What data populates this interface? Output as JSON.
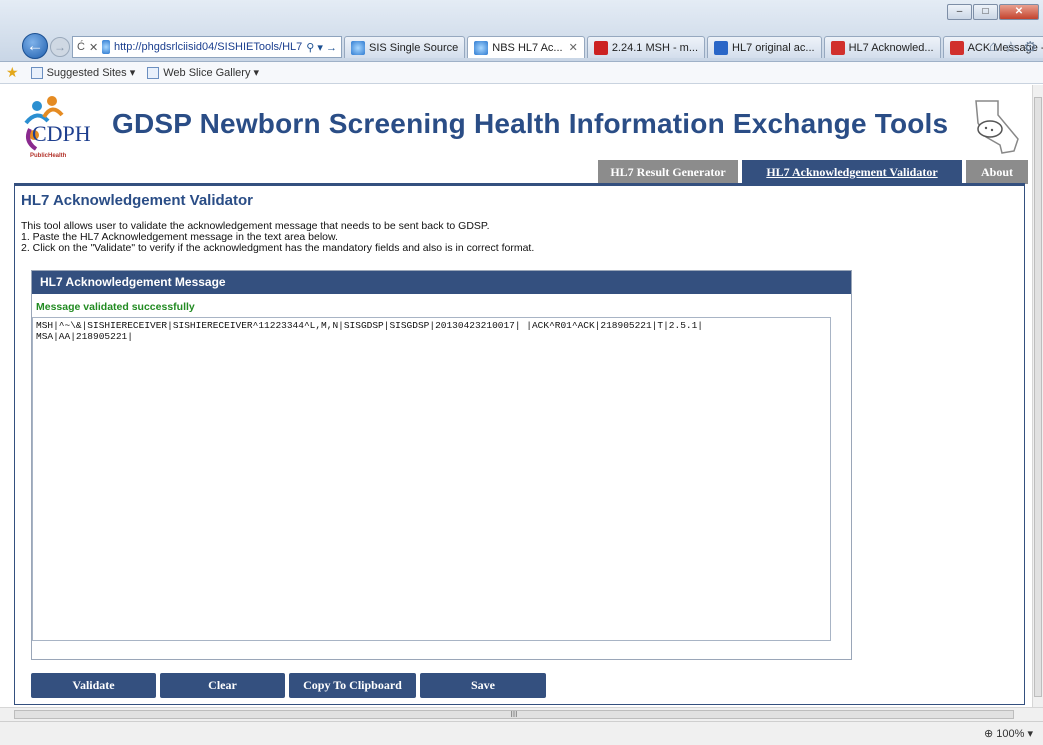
{
  "browser": {
    "url": "http://phgdsrlciisid04/SISHIETools/HL7",
    "tabs": [
      {
        "label": "SIS Single Source",
        "icon": "ie-page-icon"
      },
      {
        "label": "NBS HL7 Ac...",
        "icon": "ie-page-icon"
      },
      {
        "label": "2.24.1 MSH - m...",
        "icon": "red-page-icon"
      },
      {
        "label": "HL7 original ac...",
        "icon": "blue-page-icon"
      },
      {
        "label": "HL7 Acknowled...",
        "icon": "red-page-icon"
      },
      {
        "label": "ACK Message -...",
        "icon": "red-page-icon"
      }
    ],
    "favorites": [
      "Suggested Sites ▾",
      "Web Slice Gallery ▾"
    ],
    "zoom": "100%",
    "hscroll_glyph": "III"
  },
  "header": {
    "logo_text": "CDPH",
    "logo_sub": "PublicHealth",
    "title": "GDSP Newborn Screening Health Information Exchange Tools"
  },
  "nav": {
    "tabs": [
      {
        "label": "HL7 Result Generator",
        "active": false
      },
      {
        "label": "HL7 Acknowledgement Validator",
        "active": true
      },
      {
        "label": "About",
        "active": false
      }
    ]
  },
  "main": {
    "heading": "HL7 Acknowledgement Validator",
    "description": [
      "This tool allows user to validate the acknowledgement message that needs to be sent back to GDSP.",
      "1. Paste the HL7 Acknowledgement message in the text area below.",
      "2. Click on the \"Validate\" to verify if the acknowledgment has the mandatory fields and also is in correct format."
    ],
    "panel_title": "HL7 Acknowledgement Message",
    "status_message": "Message validated successfully",
    "message_text": "MSH|^~\\&|SISHIERECEIVER|SISHIERECEIVER^11223344^L,M,N|SISGDSP|SISGDSP|20130423210017| |ACK^R01^ACK|218905221|T|2.5.1|\nMSA|AA|218905221|",
    "buttons": {
      "validate": "Validate",
      "clear": "Clear",
      "copy": "Copy To Clipboard",
      "save": "Save"
    }
  },
  "colors": {
    "brand_blue": "#34507f",
    "title_blue": "#2a4d86",
    "inactive_tab": "#8c8c8c",
    "success_green": "#228b22"
  }
}
